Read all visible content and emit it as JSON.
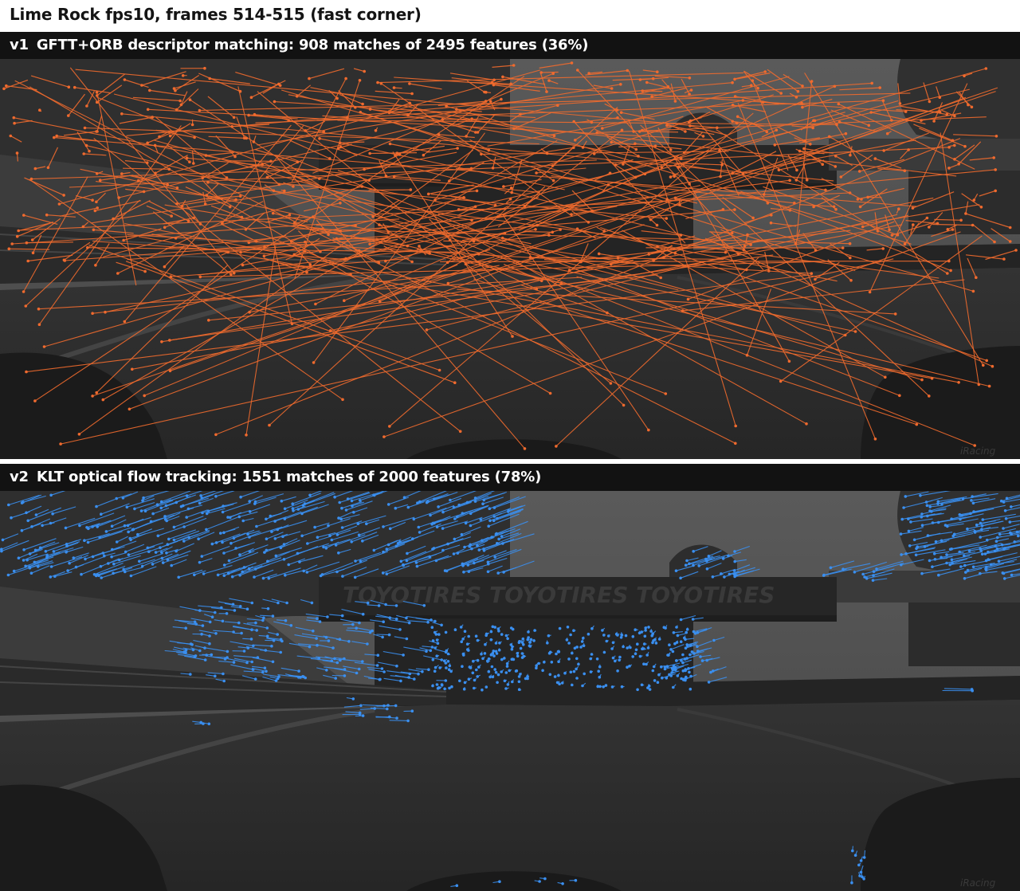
{
  "figure": {
    "title": "Lime Rock fps10, frames 514-515 (fast corner)"
  },
  "panels": [
    {
      "id": "v1",
      "version_label": "v1",
      "title": "GFTT+ORB descriptor matching: 908 matches of 2495 features (36%)",
      "method": "GFTT+ORB descriptor matching",
      "matches": 908,
      "features": 2495,
      "match_ratio_percent": 36,
      "line_color": "#f06a2e",
      "style": "long random cross-image lines (mismatches)"
    },
    {
      "id": "v2",
      "version_label": "v2",
      "title": "KLT optical flow tracking: 1551 matches of 2000 features (78%)",
      "method": "KLT optical flow tracking",
      "matches": 1551,
      "features": 2000,
      "match_ratio_percent": 78,
      "line_color": "#3a8ff0",
      "style": "short coherent flow vectors"
    }
  ],
  "scene": {
    "banner_text": "TOYOTIRES  TOYOTIRES  TOYOTIRES",
    "watermark": "iRacing",
    "colors": {
      "sky": "#4f4f4f",
      "trees": "#2e2e2e",
      "road": "#2b2b2b",
      "tire": "#1b1b1b",
      "header_bg": "#121212"
    }
  }
}
